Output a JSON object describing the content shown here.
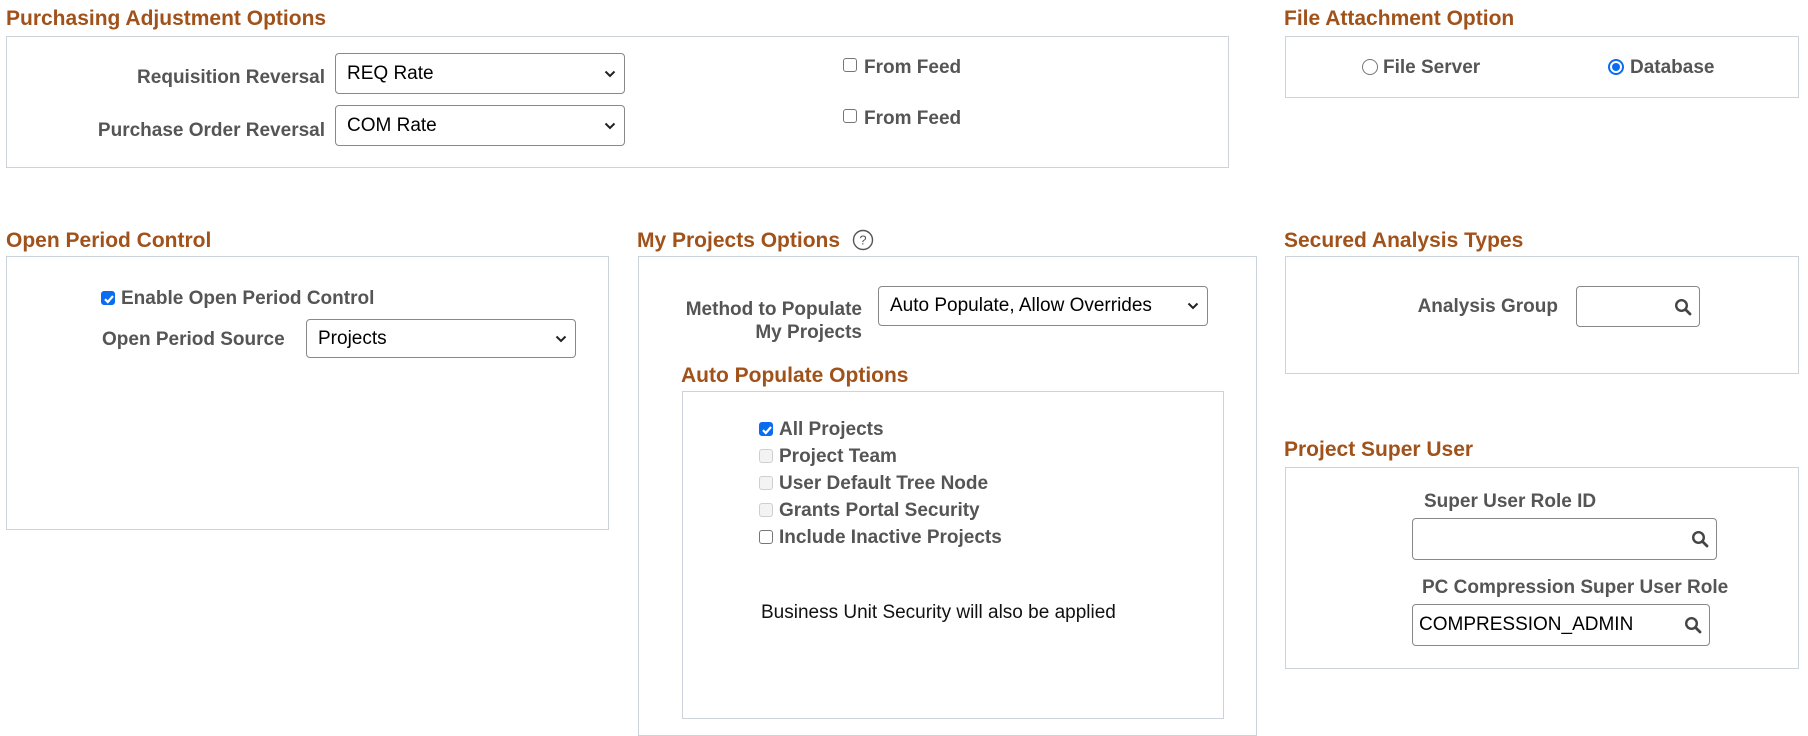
{
  "purchasing": {
    "title": "Purchasing Adjustment Options",
    "requisition_reversal": {
      "label": "Requisition Reversal",
      "value": "REQ Rate",
      "from_feed_label": "From Feed",
      "from_feed_checked": false
    },
    "po_reversal": {
      "label": "Purchase Order Reversal",
      "value": "COM Rate",
      "from_feed_label": "From Feed",
      "from_feed_checked": false
    }
  },
  "file_attachment": {
    "title": "File Attachment Option",
    "options": [
      {
        "label": "File Server",
        "selected": false
      },
      {
        "label": "Database",
        "selected": true
      }
    ]
  },
  "open_period": {
    "title": "Open Period Control",
    "enable_label": "Enable Open Period Control",
    "enable_checked": true,
    "source_label": "Open Period Source",
    "source_value": "Projects"
  },
  "my_projects": {
    "title": "My Projects Options",
    "help_icon": "question-circle-icon",
    "method_label_line1": "Method to Populate",
    "method_label_line2": "My Projects",
    "method_value": "Auto Populate, Allow Overrides",
    "auto_populate": {
      "title": "Auto Populate Options",
      "options": [
        {
          "label": "All Projects",
          "checked": true,
          "disabled": false
        },
        {
          "label": "Project Team",
          "checked": false,
          "disabled": true
        },
        {
          "label": "User Default Tree Node",
          "checked": false,
          "disabled": true
        },
        {
          "label": "Grants Portal Security",
          "checked": false,
          "disabled": true
        },
        {
          "label": "Include Inactive Projects",
          "checked": false,
          "disabled": false
        }
      ],
      "note": "Business Unit Security will also be applied"
    }
  },
  "secured_analysis": {
    "title": "Secured Analysis Types",
    "analysis_group_label": "Analysis Group",
    "analysis_group_value": ""
  },
  "super_user": {
    "title": "Project Super User",
    "role_id_label": "Super User Role ID",
    "role_id_value": "",
    "pc_label": "PC Compression Super User Role",
    "pc_value": "COMPRESSION_ADMIN"
  },
  "colors": {
    "section_title": "#a0521a",
    "accent": "#0b6cf1",
    "label": "#555555",
    "border": "#cdd3da"
  }
}
